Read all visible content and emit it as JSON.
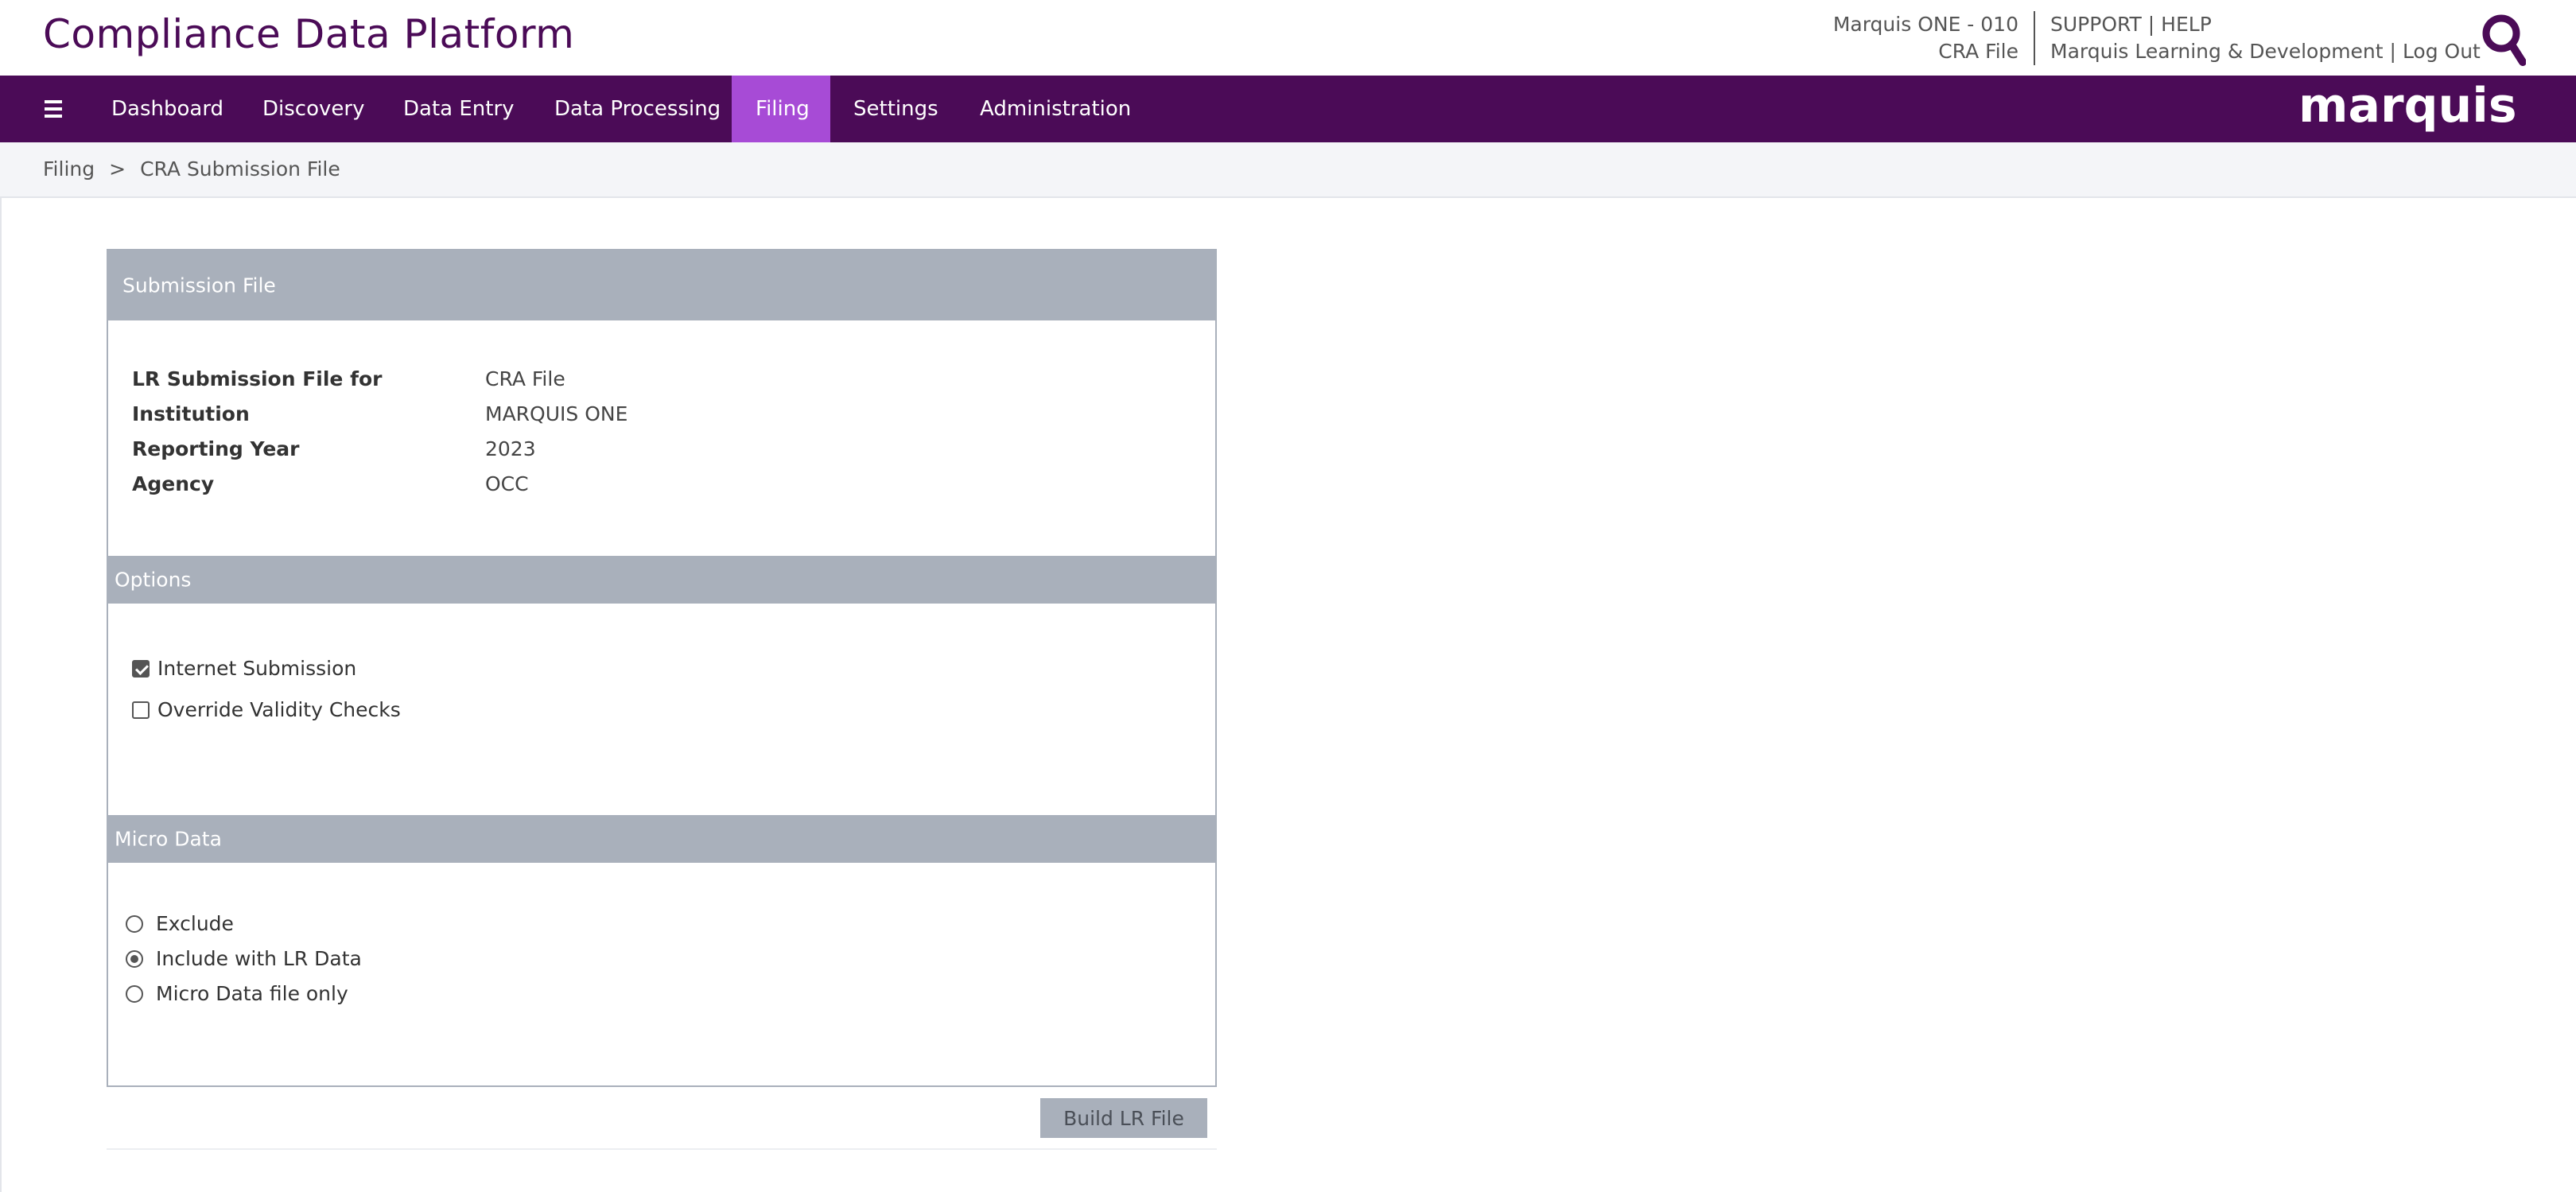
{
  "header": {
    "app_title": "Compliance Data Platform",
    "institution": "Marquis ONE - 010",
    "context_file": "CRA File",
    "support": "SUPPORT",
    "pipe": "|",
    "help": "HELP",
    "org": "Marquis Learning & Development",
    "logout": "Log Out",
    "icon": "search-icon"
  },
  "nav": {
    "menu_icon": "hamburger-menu-icon",
    "items": [
      {
        "label": "Dashboard"
      },
      {
        "label": "Discovery"
      },
      {
        "label": "Data Entry"
      },
      {
        "label": "Data Processing"
      },
      {
        "label": "Filing"
      },
      {
        "label": "Settings"
      },
      {
        "label": "Administration"
      }
    ],
    "active": "Filing",
    "brand": "marquis"
  },
  "breadcrumb": {
    "parent": "Filing",
    "separator": ">",
    "current": "CRA Submission File"
  },
  "submission": {
    "header": "Submission File",
    "fields": [
      {
        "label": "LR Submission File for",
        "value": "CRA File"
      },
      {
        "label": "Institution",
        "value": "MARQUIS ONE"
      },
      {
        "label": "Reporting Year",
        "value": "2023"
      },
      {
        "label": "Agency",
        "value": "OCC"
      }
    ]
  },
  "options": {
    "header": "Options",
    "items": [
      {
        "label": "Internet Submission",
        "checked": true
      },
      {
        "label": "Override Validity Checks",
        "checked": false
      }
    ]
  },
  "micro_data": {
    "header": "Micro Data",
    "choices": [
      {
        "label": "Exclude",
        "selected": false
      },
      {
        "label": "Include with LR Data",
        "selected": true
      },
      {
        "label": "Micro Data file only",
        "selected": false
      }
    ]
  },
  "actions": {
    "build_button": "Build LR File"
  },
  "colors": {
    "brand_purple": "#4b0b57",
    "active_tab": "#a74bd6",
    "section_header": "#a9b0bb"
  }
}
